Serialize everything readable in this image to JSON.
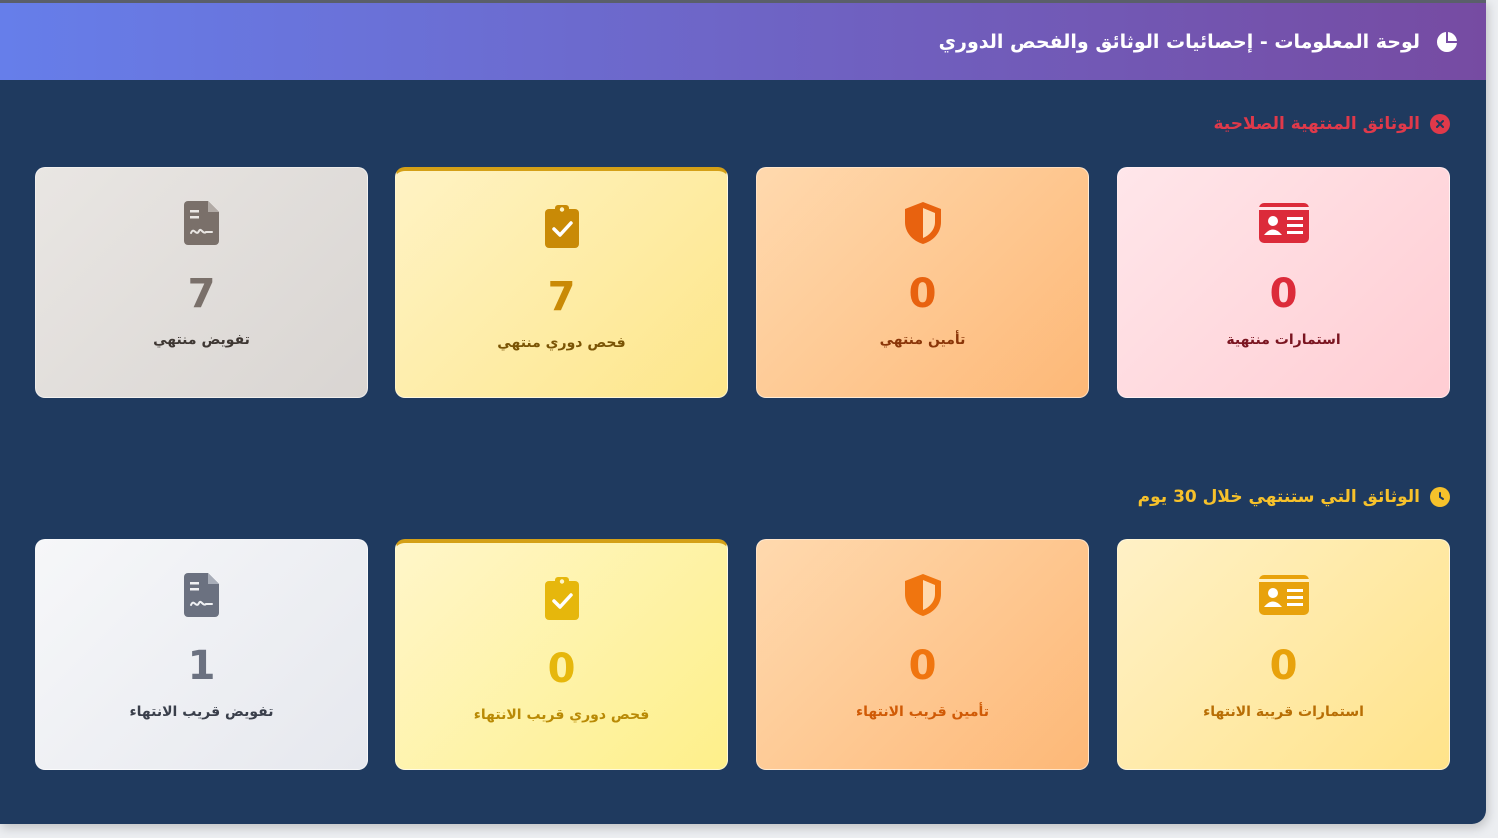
{
  "header": {
    "title": "لوحة المعلومات - إحصائيات الوثائق والفحص الدوري",
    "icon": "pie-chart-icon"
  },
  "sections": {
    "expired": {
      "title": "الوثائق المنتهية الصلاحية",
      "icon": "x-circle-icon",
      "color": "#e0394a",
      "cards": [
        {
          "value": "0",
          "label": "استمارات منتهية",
          "icon": "id-card-icon",
          "color": "#dc2b3a"
        },
        {
          "value": "0",
          "label": "تأمين منتهي",
          "icon": "shield-icon",
          "color": "#e8620f"
        },
        {
          "value": "7",
          "label": "فحص دوري منتهي",
          "icon": "clipboard-check-icon",
          "color": "#c98a06"
        },
        {
          "value": "7",
          "label": "تفويض منتهي",
          "icon": "document-signature-icon",
          "color": "#7a706a"
        }
      ]
    },
    "soon": {
      "title": "الوثائق التي ستنتهي خلال 30 يوم",
      "icon": "clock-icon",
      "color": "#f6c12b",
      "cards": [
        {
          "value": "0",
          "label": "استمارات قريبة الانتهاء",
          "icon": "id-card-icon",
          "color": "#e8a20c"
        },
        {
          "value": "0",
          "label": "تأمين قريب الانتهاء",
          "icon": "shield-icon",
          "color": "#f0750f"
        },
        {
          "value": "0",
          "label": "فحص دوري قريب الانتهاء",
          "icon": "clipboard-check-icon",
          "color": "#e6b70c"
        },
        {
          "value": "1",
          "label": "تفويض قريب الانتهاء",
          "icon": "document-signature-icon",
          "color": "#6b7180"
        }
      ]
    }
  }
}
